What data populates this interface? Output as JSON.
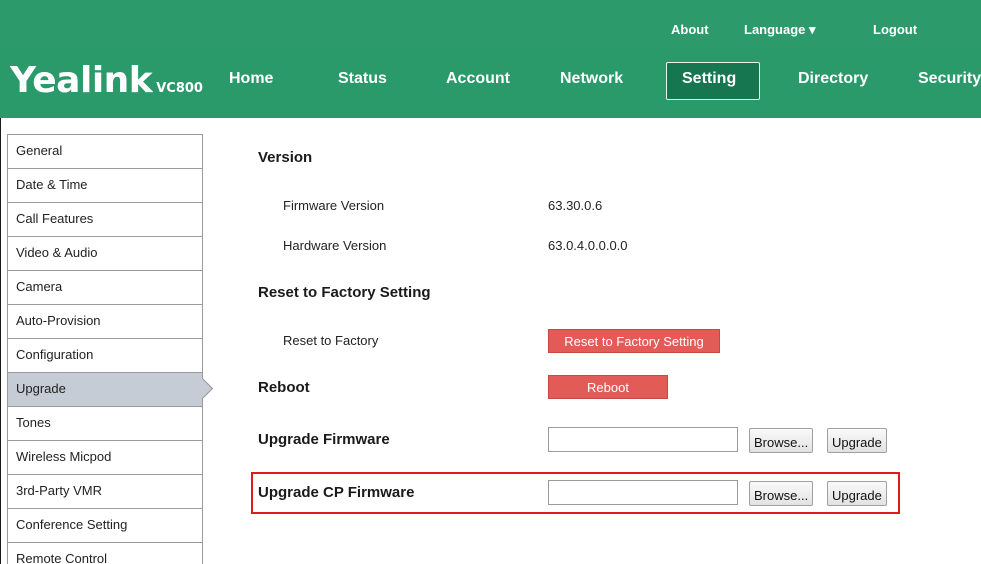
{
  "header": {
    "util_links": {
      "about": "About",
      "language": "Language ▾",
      "logout": "Logout"
    },
    "logo": {
      "brand": "Yealink",
      "model": "VC800"
    },
    "nav": {
      "home": "Home",
      "status": "Status",
      "account": "Account",
      "network": "Network",
      "setting": "Setting",
      "directory": "Directory",
      "security": "Security"
    },
    "active_nav": "Setting",
    "colors": {
      "bar": "#2a9a6b",
      "active_tab": "#15764f"
    }
  },
  "sidebar": {
    "items": [
      {
        "label": "General"
      },
      {
        "label": "Date & Time"
      },
      {
        "label": "Call Features"
      },
      {
        "label": "Video & Audio"
      },
      {
        "label": "Camera"
      },
      {
        "label": "Auto-Provision"
      },
      {
        "label": "Configuration"
      },
      {
        "label": "Upgrade"
      },
      {
        "label": "Tones"
      },
      {
        "label": "Wireless Micpod"
      },
      {
        "label": "3rd-Party VMR"
      },
      {
        "label": "Conference Setting"
      },
      {
        "label": "Remote Control"
      }
    ],
    "active_item": "Upgrade"
  },
  "content": {
    "version": {
      "title": "Version",
      "firmware_label": "Firmware Version",
      "firmware_value": "63.30.0.6",
      "hardware_label": "Hardware Version",
      "hardware_value": "63.0.4.0.0.0.0"
    },
    "reset": {
      "title": "Reset to Factory Setting",
      "label": "Reset to Factory",
      "button": "Reset to Factory Setting"
    },
    "reboot": {
      "title": "Reboot",
      "button": "Reboot"
    },
    "upgrade_firmware": {
      "title": "Upgrade Firmware",
      "browse": "Browse...",
      "upgrade": "Upgrade",
      "file_value": ""
    },
    "upgrade_cp_firmware": {
      "title": "Upgrade CP Firmware",
      "browse": "Browse...",
      "upgrade": "Upgrade",
      "file_value": ""
    },
    "colors": {
      "danger_button": "#e35b56",
      "highlight": "#e0191b"
    }
  }
}
